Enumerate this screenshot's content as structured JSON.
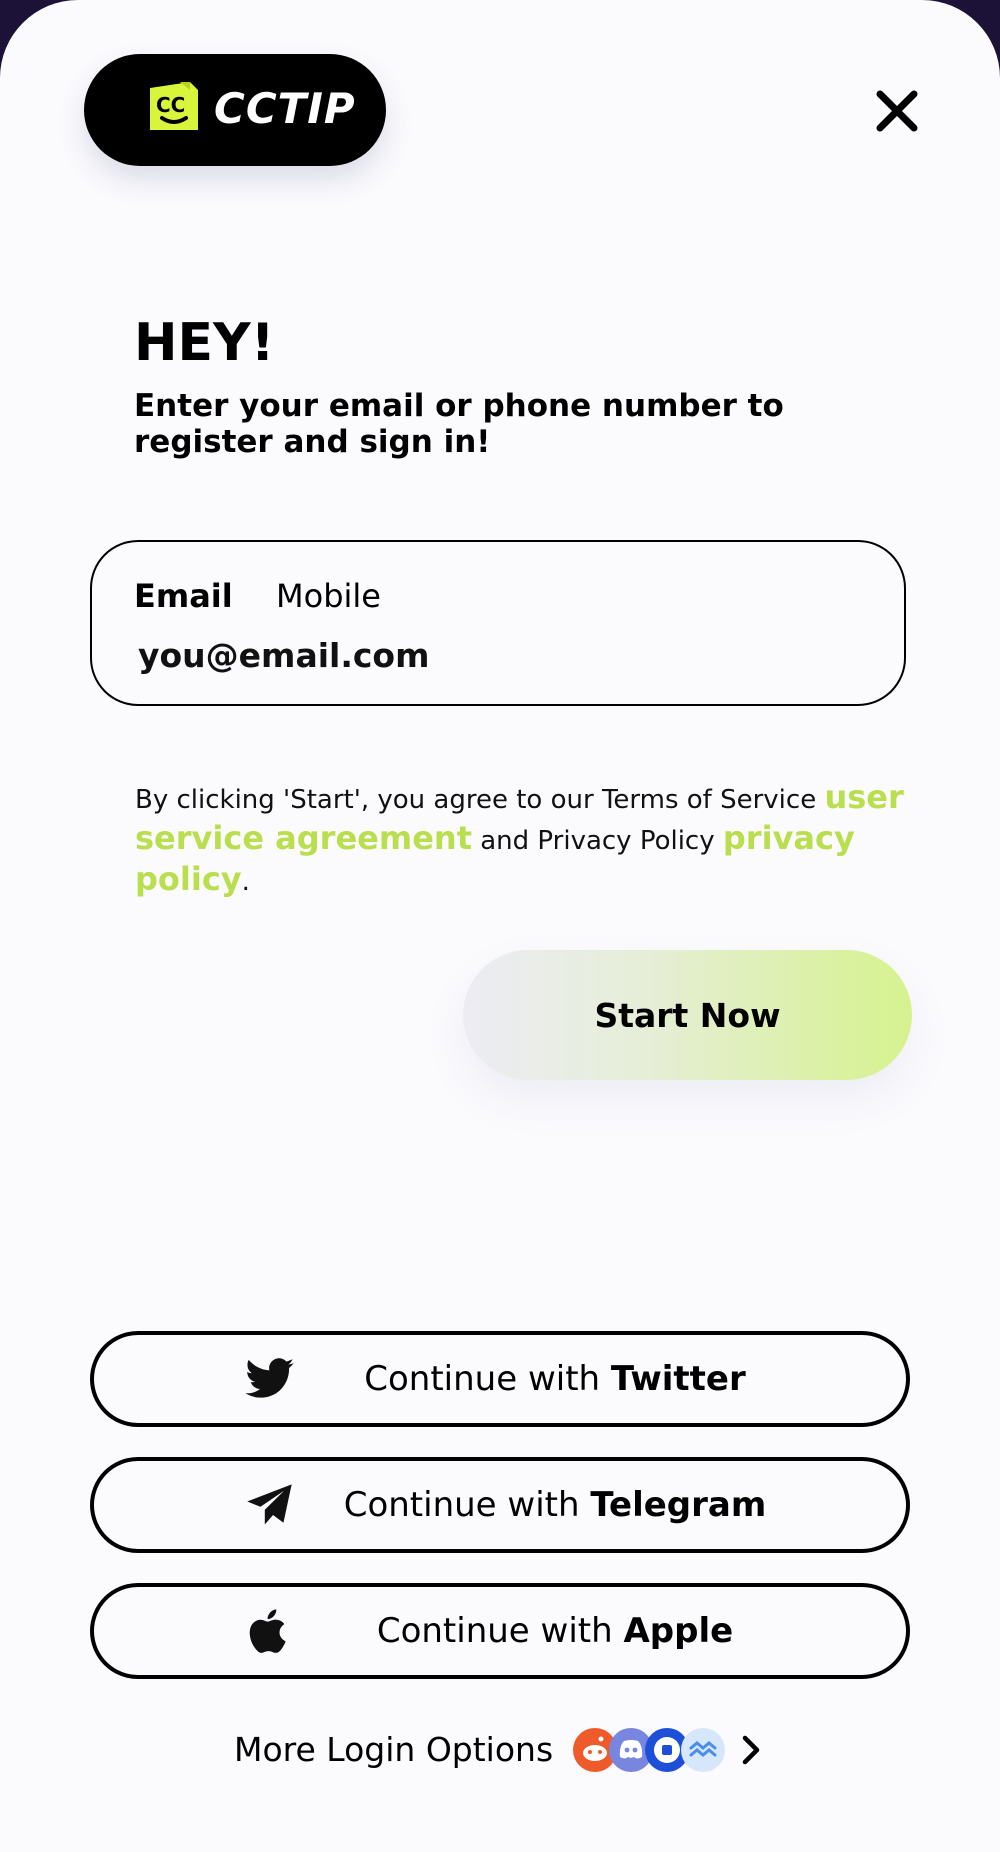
{
  "brand": {
    "name": "CCTIP",
    "accent": "#d8f53c"
  },
  "header": {
    "close_icon": "close-icon"
  },
  "hero": {
    "title": "HEY!",
    "subtitle": "Enter your email or phone number to register and sign in!"
  },
  "login_form": {
    "tabs": {
      "email": "Email",
      "mobile": "Mobile"
    },
    "email_placeholder": "you@email.com"
  },
  "terms": {
    "prefix": "By clicking 'Start', you agree to our Terms of Service ",
    "link1": "user service agreement",
    "middle": " and Privacy Policy ",
    "link2": "privacy policy",
    "suffix": ".",
    "link_color": "#b9de4e"
  },
  "start_button": {
    "label": "Start Now"
  },
  "social": [
    {
      "prefix": "Continue with ",
      "provider": "Twitter",
      "icon": "twitter-icon"
    },
    {
      "prefix": "Continue with ",
      "provider": "Telegram",
      "icon": "telegram-icon"
    },
    {
      "prefix": "Continue with ",
      "provider": "Apple",
      "icon": "apple-icon"
    }
  ],
  "more_options": {
    "label": "More Login Options",
    "icons": [
      "reddit-icon",
      "discord-icon",
      "coinbase-icon",
      "wave-icon"
    ]
  }
}
